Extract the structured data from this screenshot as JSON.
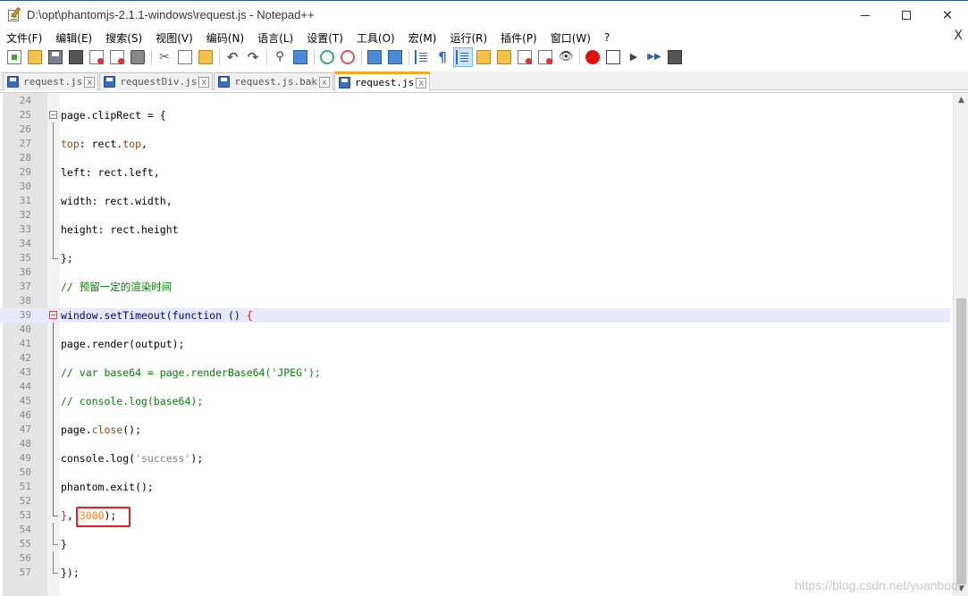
{
  "window": {
    "title": "D:\\opt\\phantomjs-2.1.1-windows\\request.js - Notepad++",
    "close_glyph": "✕",
    "doc_close_glyph": "X"
  },
  "menu": [
    {
      "label": "文件(F)"
    },
    {
      "label": "编辑(E)"
    },
    {
      "label": "搜索(S)"
    },
    {
      "label": "视图(V)"
    },
    {
      "label": "编码(N)"
    },
    {
      "label": "语言(L)"
    },
    {
      "label": "设置(T)"
    },
    {
      "label": "工具(O)"
    },
    {
      "label": "宏(M)"
    },
    {
      "label": "运行(R)"
    },
    {
      "label": "插件(P)"
    },
    {
      "label": "窗口(W)"
    },
    {
      "label": "?"
    }
  ],
  "toolbar": {
    "icons": [
      "new-file-icon",
      "open-file-icon",
      "save-icon",
      "save-all-icon",
      "close-file-icon",
      "close-all-icon",
      "print-icon",
      "cut-icon",
      "copy-icon",
      "paste-icon",
      "undo-icon",
      "redo-icon",
      "find-icon",
      "replace-icon",
      "zoom-in-icon",
      "zoom-out-icon",
      "sync-vertical-icon",
      "sync-horizontal-icon",
      "word-wrap-icon",
      "show-all-chars-icon",
      "indent-guide-icon",
      "user-lang-icon",
      "doc-map-icon",
      "function-list-icon",
      "folder-workspace-icon",
      "monitoring-icon",
      "record-macro-icon",
      "stop-recording-icon",
      "playback-macro-icon",
      "run-macro-multiple-icon",
      "save-macro-icon"
    ]
  },
  "tabs": [
    {
      "label": "request.js",
      "active": false,
      "close": "x"
    },
    {
      "label": "requestDiv.js",
      "active": false,
      "close": "x"
    },
    {
      "label": "request.js.bak",
      "active": false,
      "close": "x"
    },
    {
      "label": "request.js",
      "active": true,
      "close": "x"
    }
  ],
  "editor": {
    "lines": [
      {
        "num": "24"
      },
      {
        "num": "25"
      },
      {
        "num": "26"
      },
      {
        "num": "27"
      },
      {
        "num": "28"
      },
      {
        "num": "29"
      },
      {
        "num": "30"
      },
      {
        "num": "31"
      },
      {
        "num": "32"
      },
      {
        "num": "33"
      },
      {
        "num": "34"
      },
      {
        "num": "35"
      },
      {
        "num": "36"
      },
      {
        "num": "37"
      },
      {
        "num": "38"
      },
      {
        "num": "39"
      },
      {
        "num": "40"
      },
      {
        "num": "41"
      },
      {
        "num": "42"
      },
      {
        "num": "43"
      },
      {
        "num": "44"
      },
      {
        "num": "45"
      },
      {
        "num": "46"
      },
      {
        "num": "47"
      },
      {
        "num": "48"
      },
      {
        "num": "49"
      },
      {
        "num": "50"
      },
      {
        "num": "51"
      },
      {
        "num": "52"
      },
      {
        "num": "53"
      },
      {
        "num": "54"
      },
      {
        "num": "55"
      },
      {
        "num": "56"
      },
      {
        "num": "57"
      }
    ],
    "code": {
      "l25_a": "page.clipRect = ",
      "l25_b": "{",
      "l27_a": "top",
      "l27_b": ": rect.",
      "l27_c": "top",
      "l27_d": ",",
      "l29": "left: rect.left,",
      "l31": "width: rect.width,",
      "l33": "height: rect.height",
      "l35": "};",
      "l37": "// 预留一定的渲染时间",
      "l39_a": "window.setTimeout",
      "l39_b": "(function () ",
      "l39_c": "{",
      "l41": "page.render(output);",
      "l43": "// var base64 = page.renderBase64('JPEG');",
      "l45": "// console.log(base64);",
      "l47_a": "page.",
      "l47_b": "close",
      "l47_c": "();",
      "l49_a": "console.log(",
      "l49_b": "'success'",
      "l49_c": ");",
      "l51": "phantom.exit();",
      "l53_a": "}",
      "l53_b": ", ",
      "l53_c": "3000",
      "l53_d": ");",
      "l55": "}",
      "l57": "});"
    }
  },
  "scrollbar": {
    "up": "▲",
    "down": "▼"
  },
  "watermark": "https://blog.csdn.net/yuanboqi"
}
